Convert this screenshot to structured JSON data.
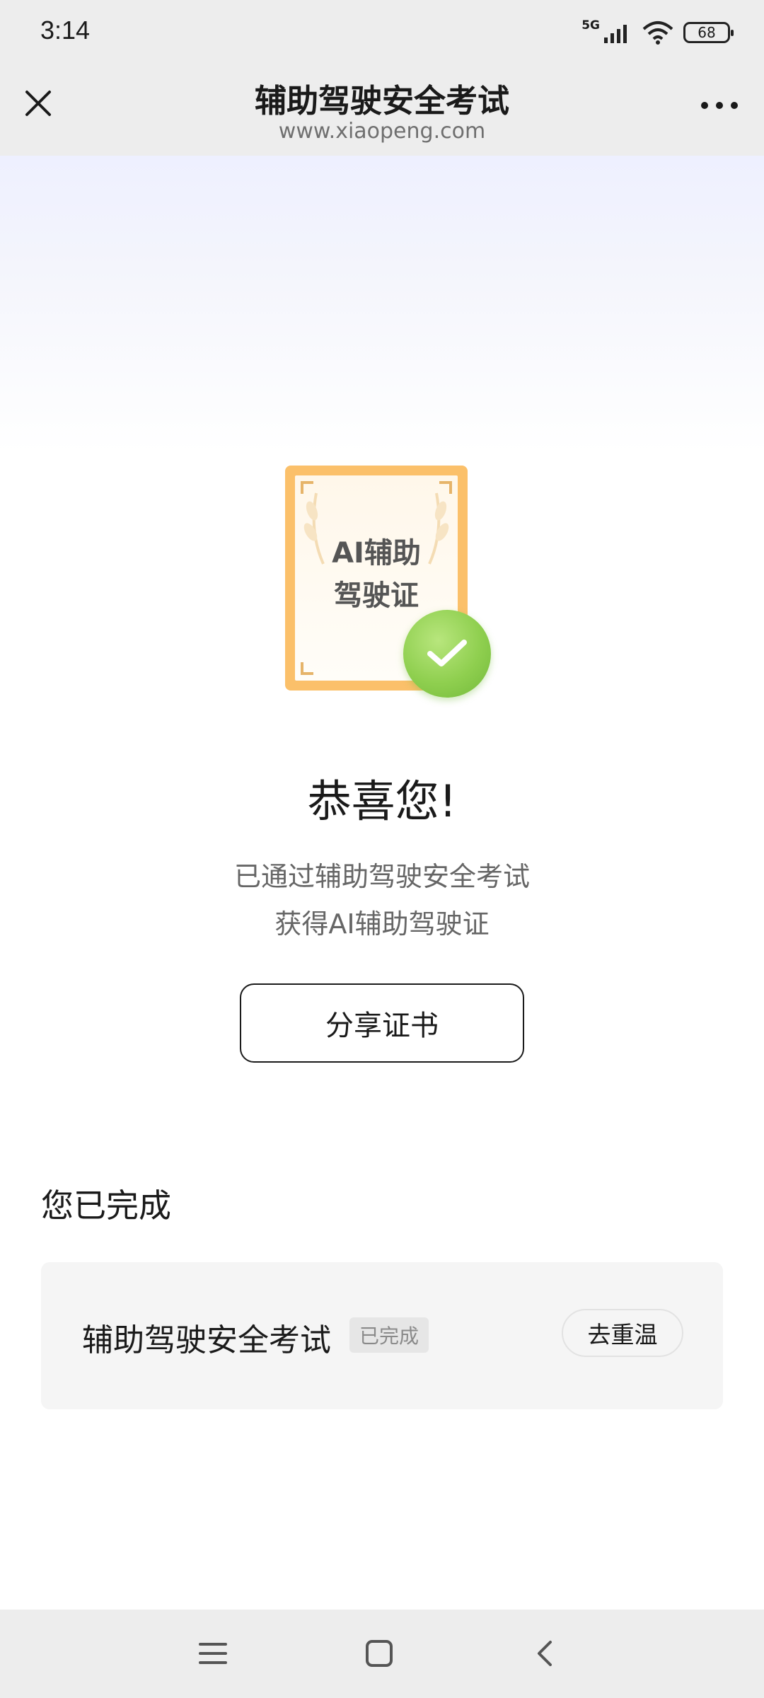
{
  "status_bar": {
    "time": "3:14",
    "network": "5G",
    "battery": "68"
  },
  "nav": {
    "title": "辅助驾驶安全考试",
    "url": "www.xiaopeng.com"
  },
  "certificate": {
    "line1": "AI辅助",
    "line2": "驾驶证"
  },
  "result": {
    "congrats": "恭喜您!",
    "line1": "已通过辅助驾驶安全考试",
    "line2": "获得AI辅助驾驶证",
    "share_label": "分享证书"
  },
  "completed_section": {
    "title": "您已完成",
    "items": [
      {
        "name": "辅助驾驶安全考试",
        "badge": "已完成",
        "action": "去重温"
      }
    ]
  },
  "colors": {
    "cert_frame": "#fbc06a",
    "check_green": "#8fcf4f",
    "header_bg": "#ededed"
  }
}
